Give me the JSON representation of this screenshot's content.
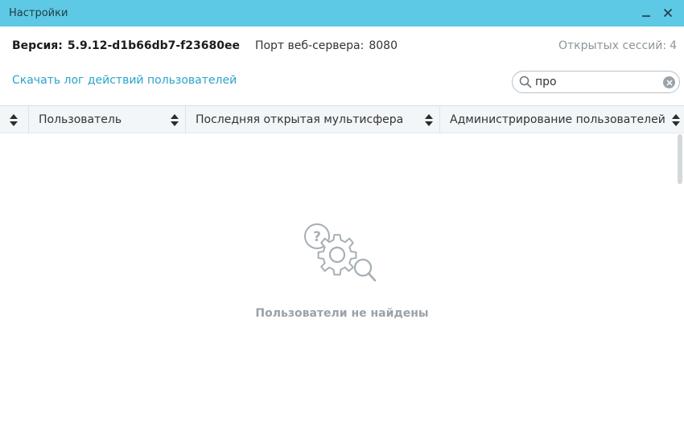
{
  "window": {
    "title": "Настройки"
  },
  "info": {
    "version_label": "Версия:",
    "version_value": "5.9.12-d1b66db7-f23680ee",
    "port_label": "Порт веб-сервера:",
    "port_value": "8080",
    "sessions_label": "Открытых сессий:",
    "sessions_value": "4"
  },
  "actions": {
    "download_log": "Скачать лог действий пользователей"
  },
  "search": {
    "value": "про",
    "placeholder": ""
  },
  "table": {
    "columns": [
      {
        "label": "Пользователь"
      },
      {
        "label": "Последняя открытая мультисфера"
      },
      {
        "label": "Администрирование пользователей"
      }
    ]
  },
  "empty_state": {
    "message": "Пользователи не найдены"
  },
  "colors": {
    "titlebar": "#5ec9e4",
    "link": "#2aa4cb",
    "muted": "#8d959b"
  }
}
